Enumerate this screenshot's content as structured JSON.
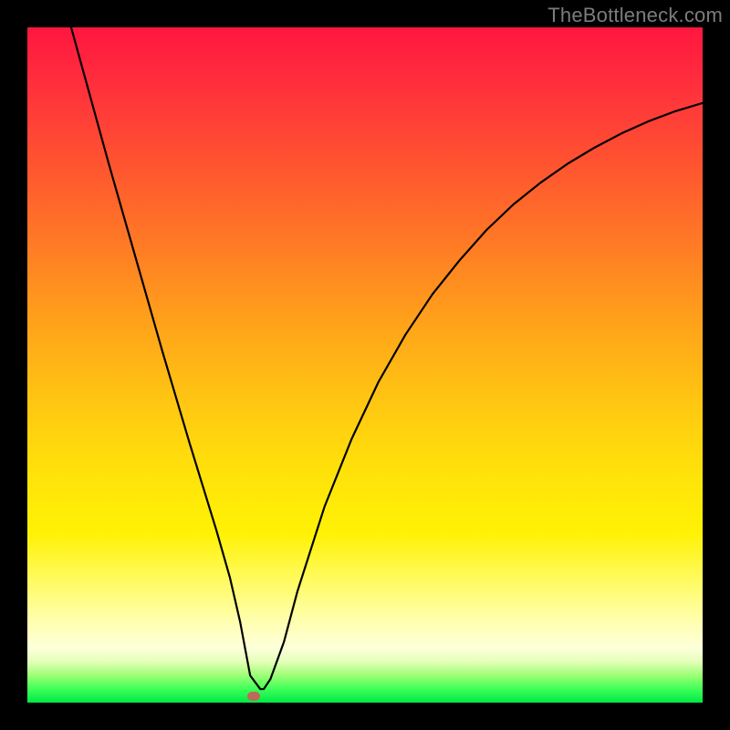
{
  "watermark": "TheBottleneck.com",
  "colors": {
    "frame": "#000000",
    "gradient_top": "#ff163f",
    "gradient_bottom": "#00e947",
    "curve": "#000000",
    "marker": "#bb6b57",
    "watermark": "#7c7c7c"
  },
  "chart_data": {
    "type": "line",
    "title": "",
    "xlabel": "",
    "ylabel": "",
    "xlim": [
      0,
      100
    ],
    "ylim": [
      0,
      100
    ],
    "marker_point": {
      "x": 33.5,
      "y": 1
    },
    "series": [
      {
        "name": "bottleneck-curve",
        "x": [
          0,
          4,
          8,
          12,
          16,
          20,
          24,
          28,
          30,
          31.5,
          33,
          34.5,
          35,
          36,
          38,
          40,
          44,
          48,
          52,
          56,
          60,
          64,
          68,
          72,
          76,
          80,
          84,
          88,
          92,
          96,
          100
        ],
        "y": [
          125,
          109,
          94.5,
          80,
          66,
          52,
          38.5,
          25.5,
          18.5,
          12,
          4,
          2,
          2,
          3.5,
          9,
          16.5,
          29,
          39,
          47.5,
          54.5,
          60.5,
          65.5,
          70,
          73.8,
          77,
          79.8,
          82.2,
          84.3,
          86.1,
          87.6,
          88.8
        ]
      }
    ],
    "annotations": []
  }
}
